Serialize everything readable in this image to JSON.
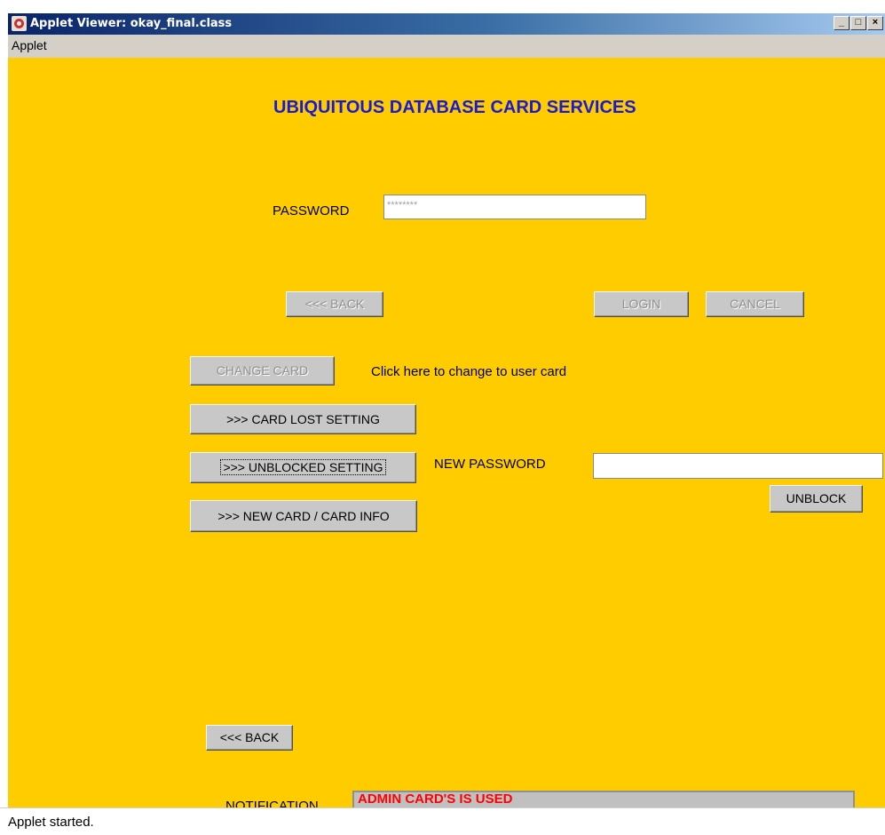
{
  "window": {
    "title": "Applet Viewer: okay_final.class",
    "icon": "applet-viewer-icon",
    "controls": {
      "minimize": "_",
      "maximize": "□",
      "close": "×"
    }
  },
  "menubar": {
    "items": [
      "Applet"
    ]
  },
  "applet": {
    "heading": "UBIQUITOUS DATABASE CARD SERVICES",
    "password_label": "PASSWORD",
    "password_value": "********",
    "back_top_label": "<<< BACK",
    "login_label": "LOGIN",
    "cancel_label": "CANCEL",
    "change_card_label": "CHANGE CARD",
    "change_card_hint": "Click here to change to user card",
    "card_lost_label": ">>> CARD LOST SETTING",
    "unblocked_label": ">>> UNBLOCKED SETTING",
    "new_password_label": "NEW PASSWORD",
    "new_password_value": "",
    "unblock_label": "UNBLOCK",
    "new_card_label": ">>> NEW CARD / CARD INFO",
    "back_bottom_label": "<<< BACK",
    "notification_label": "NOTIFICATION",
    "notification_value": "ADMIN CARD'S IS USED"
  },
  "status": {
    "text": "Applet started."
  },
  "colors": {
    "applet_background": "#ffcc00",
    "heading": "#1a1ad6",
    "notification_text": "#ff0000",
    "titlebar_start": "#0a246a",
    "button_face": "#c8c8c8"
  }
}
